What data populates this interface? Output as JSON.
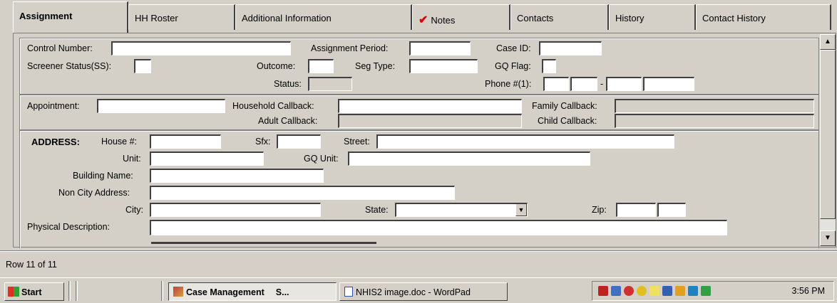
{
  "tabs": [
    {
      "label": "Assignment",
      "active": true
    },
    {
      "label": "HH Roster"
    },
    {
      "label": "Additional Information"
    },
    {
      "label": "Notes",
      "checked": true
    },
    {
      "label": "Contacts"
    },
    {
      "label": "History"
    },
    {
      "label": "Contact History"
    }
  ],
  "top": {
    "control_number": "Control Number:",
    "assignment_period": "Assignment Period:",
    "case_id": "Case ID:",
    "screener_status": "Screener Status(SS):",
    "outcome": "Outcome:",
    "seg_type": "Seg Type:",
    "gq_flag": "GQ Flag:",
    "status": "Status:",
    "phone": "Phone #(1):",
    "phone_dash": "-"
  },
  "callback": {
    "appointment": "Appointment:",
    "household": "Household Callback:",
    "adult": "Adult Callback:",
    "family": "Family Callback:",
    "child": "Child Callback:"
  },
  "address": {
    "heading": "ADDRESS:",
    "house": "House #:",
    "sfx": "Sfx:",
    "street": "Street:",
    "unit": "Unit:",
    "gq_unit": "GQ Unit:",
    "building": "Building Name:",
    "non_city": "Non City Address:",
    "city": "City:",
    "state": "State:",
    "zip": "Zip:",
    "physical": "Physical Description:"
  },
  "status_bar": "Row 11 of 11",
  "taskbar": {
    "start": "Start",
    "app1": "Case Management",
    "app1_suffix": "S...",
    "app2": "NHIS2 image.doc - WordPad",
    "clock": "3:56 PM"
  },
  "colors": {
    "check": "#e00000",
    "face": "#d4d0c8"
  }
}
